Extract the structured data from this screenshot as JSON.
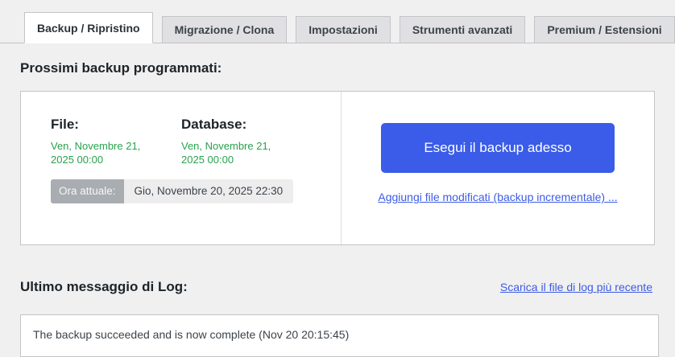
{
  "tabs": [
    {
      "label": "Backup / Ripristino",
      "active": true
    },
    {
      "label": "Migrazione / Clona",
      "active": false
    },
    {
      "label": "Impostazioni",
      "active": false
    },
    {
      "label": "Strumenti avanzati",
      "active": false
    },
    {
      "label": "Premium / Estensioni",
      "active": false
    }
  ],
  "scheduled": {
    "title": "Prossimi backup programmati:",
    "files_label": "File:",
    "files_next": "Ven, Novembre 21, 2025 00:00",
    "database_label": "Database:",
    "database_next": "Ven, Novembre 21, 2025 00:00",
    "current_time_label": "Ora attuale:",
    "current_time_value": "Gio, Novembre 20, 2025 22:30",
    "backup_button_label": "Esegui il backup adesso",
    "incremental_link_label": "Aggiungi file modificati (backup incrementale) ..."
  },
  "log": {
    "title": "Ultimo messaggio di Log:",
    "download_link_label": "Scarica il file di log più recente",
    "message": "The backup succeeded and is now complete (Nov 20 20:15:45)"
  },
  "colors": {
    "page_background": "#f0f0f1",
    "panel_background": "#ffffff",
    "border": "#c3c4c7",
    "accent_blue": "#3a5ce8",
    "link_blue": "#3c5be4",
    "success_green": "#2aa14d",
    "badge_label_background": "#a9acb0",
    "badge_value_background": "#ededee"
  }
}
